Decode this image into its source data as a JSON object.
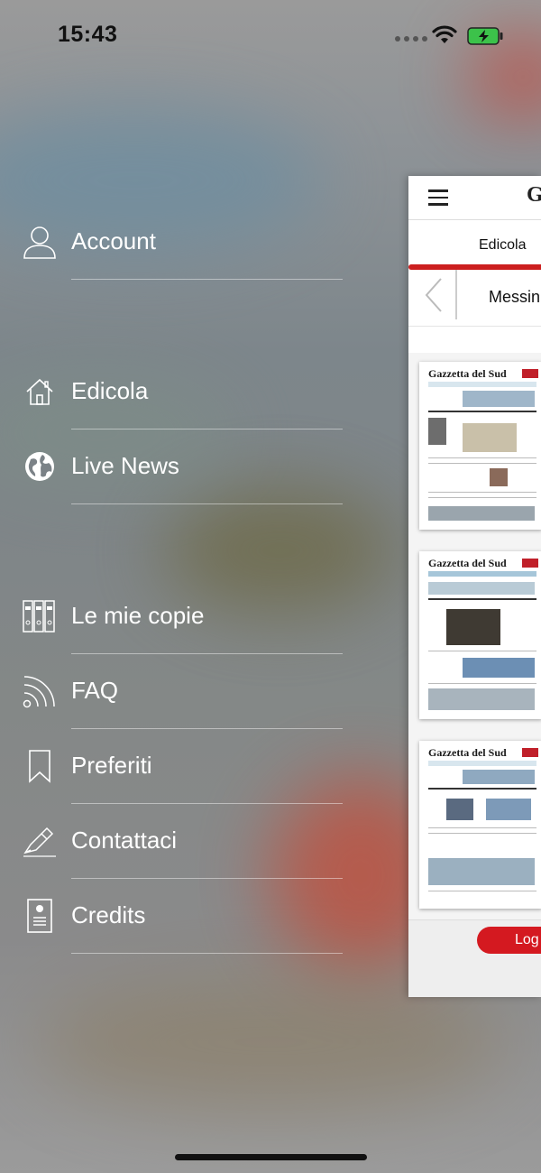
{
  "status_bar": {
    "time": "15:43"
  },
  "menu": {
    "items": [
      {
        "label": "Account",
        "icon": "user-icon"
      },
      {
        "label": "Edicola",
        "icon": "home-icon"
      },
      {
        "label": "Live News",
        "icon": "globe-icon"
      },
      {
        "label": "Le mie copie",
        "icon": "binders-icon"
      },
      {
        "label": "FAQ",
        "icon": "rss-icon"
      },
      {
        "label": "Preferiti",
        "icon": "bookmark-icon"
      },
      {
        "label": "Contattaci",
        "icon": "pen-icon"
      },
      {
        "label": "Credits",
        "icon": "id-card-icon"
      }
    ]
  },
  "preview": {
    "logo_letter": "G",
    "tab": "Edicola",
    "city": "Messin",
    "papers": [
      {
        "title": "Gazzetta del Sud"
      },
      {
        "title": "Gazzetta del Sud"
      },
      {
        "title": "Gazzetta del Sud"
      }
    ],
    "login_label": "Log",
    "accent_color": "#cc1f1f"
  }
}
